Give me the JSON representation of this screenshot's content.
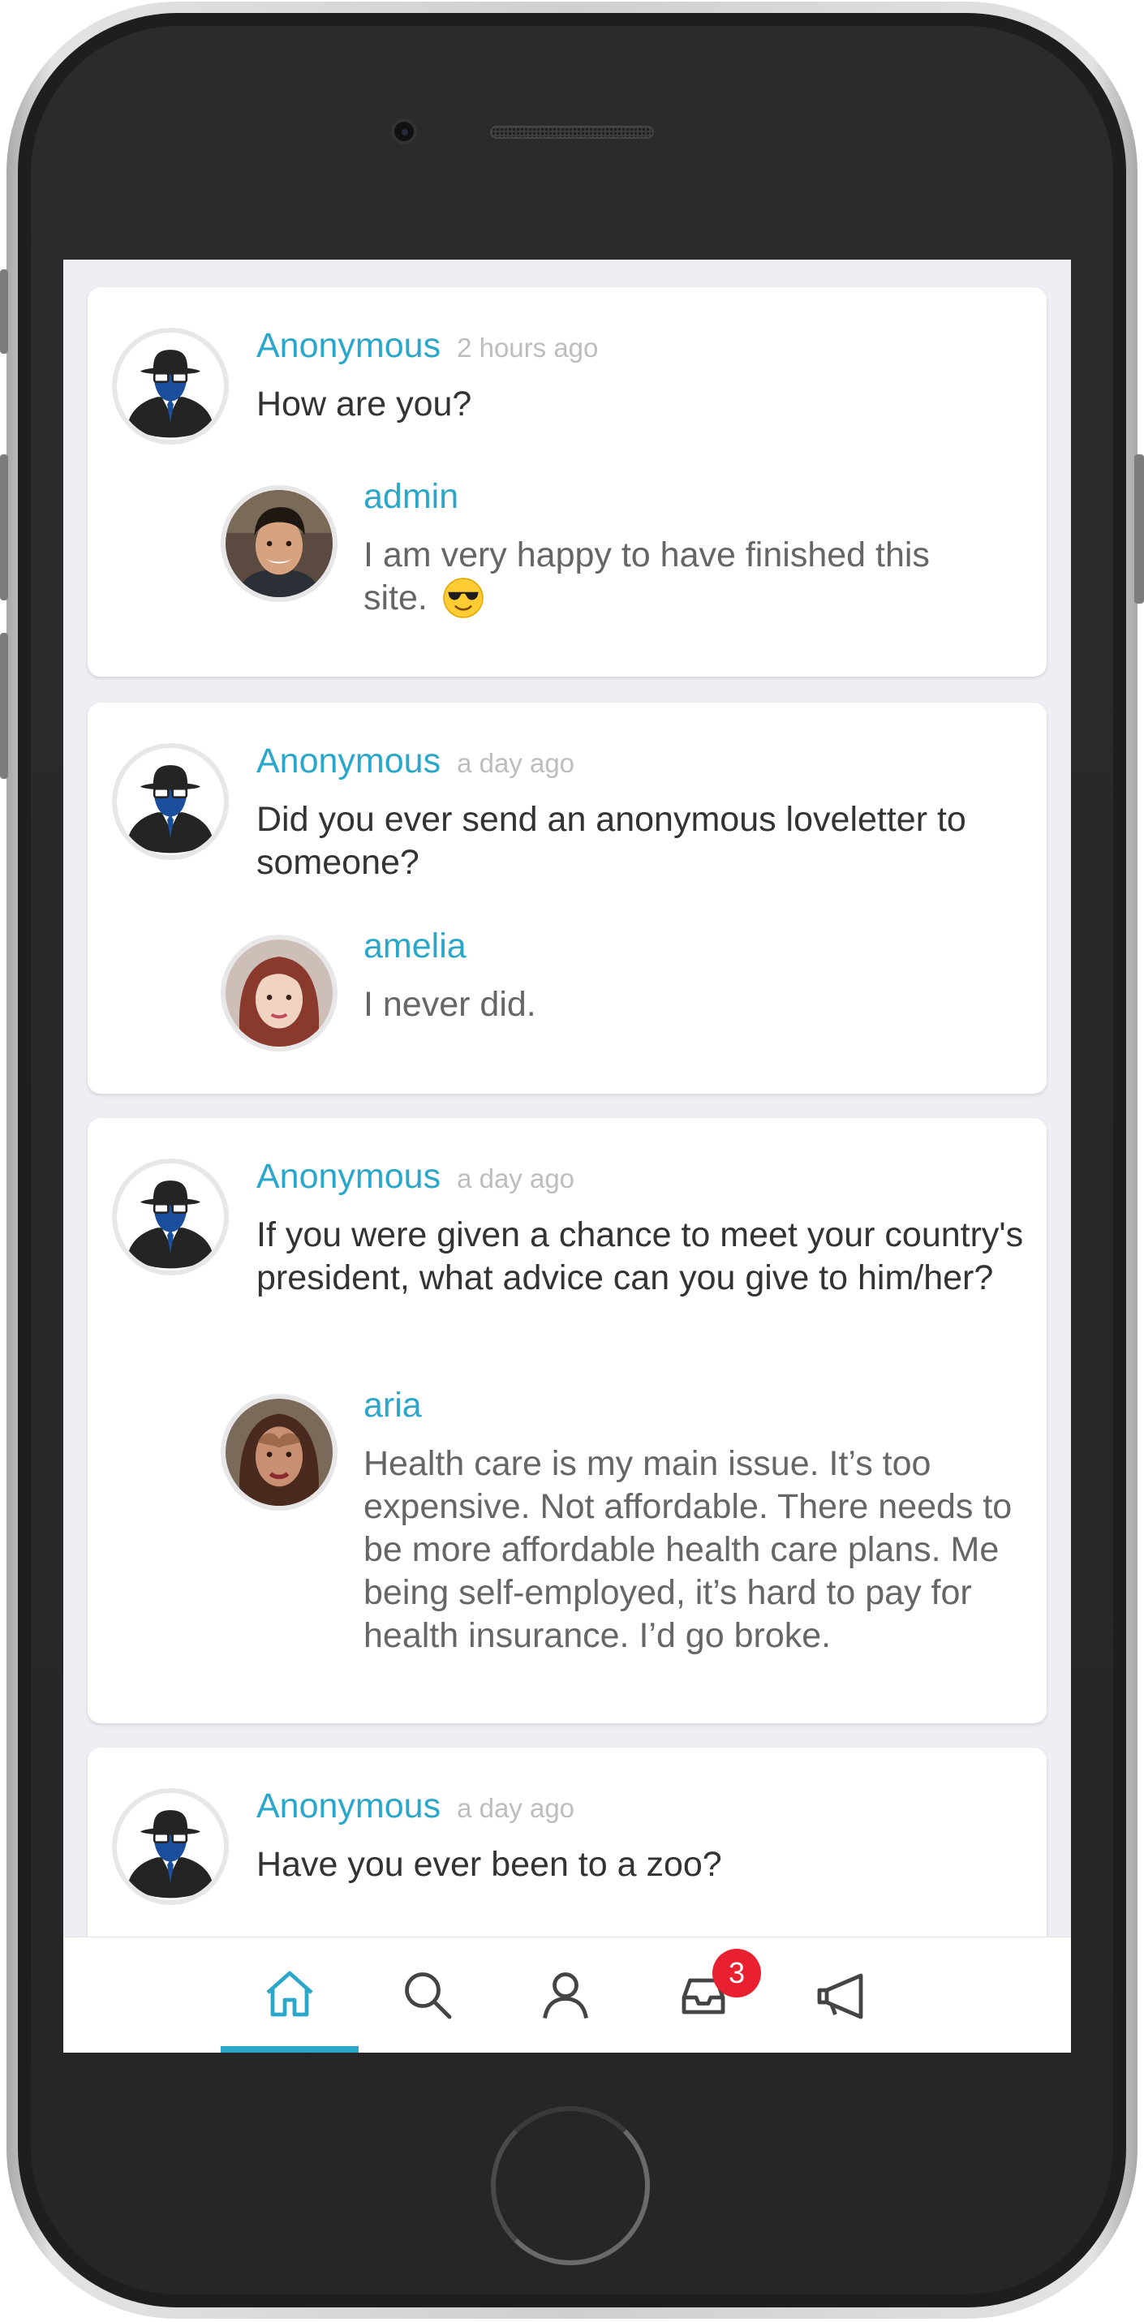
{
  "questions": [
    {
      "asker": "Anonymous",
      "time": "2 hours ago",
      "question": "How are you?",
      "answer_user": "admin",
      "answer_line1": "I am very happy to have finished this",
      "answer_line2": "site."
    },
    {
      "asker": "Anonymous",
      "time": "a day ago",
      "question": "Did you ever send an anonymous loveletter to someone?",
      "answer_user": "amelia",
      "answer": "I never did."
    },
    {
      "asker": "Anonymous",
      "time": "a day ago",
      "question": "If you were given a chance to meet your country's president, what advice can you give to him/her?",
      "answer_user": "aria",
      "answer": "Health care is my main issue. It’s too expensive. Not affordable. There needs to be more affordable health care plans. Me being self-employed, it’s hard to pay for health insurance. I’d go broke."
    },
    {
      "asker": "Anonymous",
      "time": "a day ago",
      "question": "Have you ever been to a zoo?"
    }
  ],
  "tabbar": {
    "tabs": [
      "home-icon",
      "search-icon",
      "profile-icon",
      "inbox-icon",
      "megaphone-icon"
    ],
    "active": "home-icon",
    "inbox_badge": "3"
  },
  "colors": {
    "accent": "#2ba7c9",
    "badge": "#e8202f",
    "timestamp": "#bdbdbd",
    "screen_bg": "#eeeff4"
  }
}
